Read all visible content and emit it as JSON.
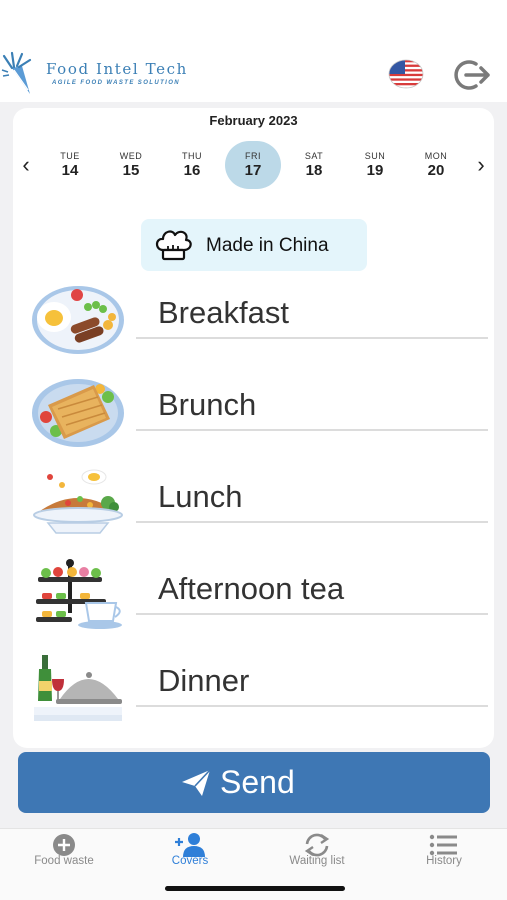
{
  "header": {
    "logo_title": "Food Intel Tech",
    "logo_subtitle": "AGILE FOOD WASTE SOLUTION",
    "language_icon": "us-flag-icon",
    "logout_icon": "logout-icon"
  },
  "calendar": {
    "month": "February 2023",
    "prev_icon": "chevron-left-icon",
    "next_icon": "chevron-right-icon",
    "days": [
      {
        "dow": "TUE",
        "num": "14"
      },
      {
        "dow": "WED",
        "num": "15"
      },
      {
        "dow": "THU",
        "num": "16"
      },
      {
        "dow": "FRI",
        "num": "17",
        "selected": true
      },
      {
        "dow": "SAT",
        "num": "18"
      },
      {
        "dow": "SUN",
        "num": "19"
      },
      {
        "dow": "MON",
        "num": "20"
      }
    ]
  },
  "badge": {
    "icon": "chef-hat-icon",
    "label": "Made in China"
  },
  "meals": [
    {
      "name": "Breakfast",
      "icon": "breakfast-plate-icon"
    },
    {
      "name": "Brunch",
      "icon": "sandwich-plate-icon"
    },
    {
      "name": "Lunch",
      "icon": "rice-plate-icon"
    },
    {
      "name": "Afternoon tea",
      "icon": "tea-stand-icon"
    },
    {
      "name": "Dinner",
      "icon": "cloche-wine-icon"
    }
  ],
  "send_button": {
    "label": "Send",
    "icon": "paper-plane-icon"
  },
  "tabs": [
    {
      "label": "Food waste",
      "icon": "plus-circle-icon"
    },
    {
      "label": "Covers",
      "icon": "add-user-icon",
      "active": true
    },
    {
      "label": "Waiting list",
      "icon": "sync-icon"
    },
    {
      "label": "History",
      "icon": "list-icon"
    }
  ],
  "colors": {
    "accent": "#3e77b4",
    "selected_day": "#bcd9e8",
    "active_tab": "#2f7fd8",
    "badge_bg": "#e4f5fb"
  }
}
